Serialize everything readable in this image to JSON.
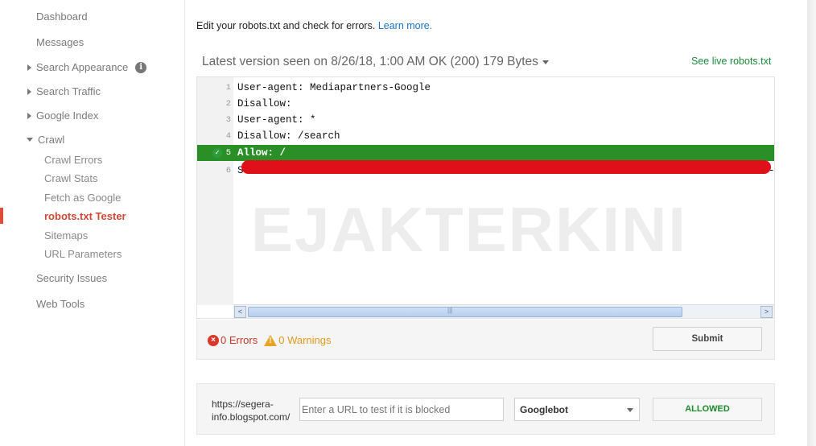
{
  "sidebar": {
    "items": {
      "dashboard": "Dashboard",
      "messages": "Messages",
      "search_appearance": "Search Appearance",
      "search_traffic": "Search Traffic",
      "google_index": "Google Index",
      "crawl": "Crawl",
      "security_issues": "Security Issues",
      "web_tools": "Web Tools"
    },
    "crawl_sub": {
      "crawl_errors": "Crawl Errors",
      "crawl_stats": "Crawl Stats",
      "fetch_as_google": "Fetch as Google",
      "robots_tester": "robots.txt Tester",
      "sitemaps": "Sitemaps",
      "url_parameters": "URL Parameters"
    },
    "info_icon_glyph": "i"
  },
  "main": {
    "intro_text": "Edit your robots.txt and check for errors.",
    "learn_more": "Learn more.",
    "version_text": "Latest version seen on 8/26/18, 1:00 AM OK (200) 179 Bytes",
    "see_live": "See live robots.txt"
  },
  "editor": {
    "lines": [
      {
        "num": "1",
        "code": "User-agent: Mediapartners-Google"
      },
      {
        "num": "2",
        "code": "Disallow:"
      },
      {
        "num": "3",
        "code": "User-agent: *"
      },
      {
        "num": "4",
        "code": "Disallow: /search"
      },
      {
        "num": "5",
        "code": "Allow: /"
      },
      {
        "num": "6",
        "code": "S"
      }
    ],
    "highlight_line": 5,
    "line6_tail": "-",
    "watermark": "EJAKTERKINI",
    "scroll_left": "<",
    "scroll_right": ">",
    "scroll_grip": "|||"
  },
  "status": {
    "errors": "0 Errors",
    "warnings": "0 Warnings",
    "submit": "Submit",
    "error_glyph": "×",
    "warning_glyph": "!"
  },
  "tester": {
    "url_prefix": "https://segera-info.blogspot.com/",
    "url_placeholder": "Enter a URL to test if it is blocked",
    "bot_selected": "Googlebot",
    "result": "ALLOWED"
  },
  "colors": {
    "accent_active": "#d14836",
    "highlight_line": "#2a8f26",
    "redaction": "#e0101b",
    "allowed": "#1d8a2e"
  }
}
